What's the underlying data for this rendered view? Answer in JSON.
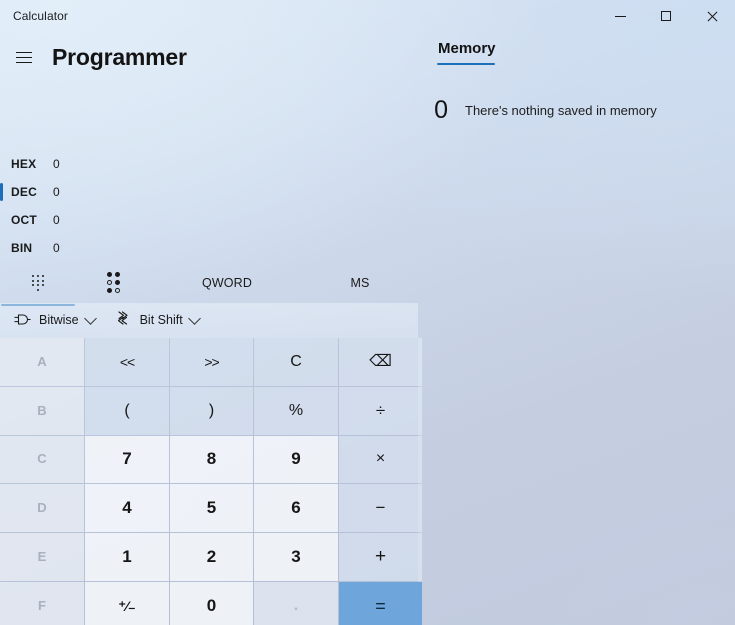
{
  "window": {
    "app_title": "Calculator",
    "controls": {
      "minimize": "minimize-button",
      "maximize": "maximize-button",
      "close": "close-button"
    }
  },
  "header": {
    "menu_icon": "hamburger-icon",
    "mode_title": "Programmer"
  },
  "memory": {
    "tab_label": "Memory",
    "result_value": "0",
    "empty_text": "There's nothing saved in memory"
  },
  "radix": {
    "rows": [
      {
        "label": "HEX",
        "value": "0",
        "selected": false
      },
      {
        "label": "DEC",
        "value": "0",
        "selected": true
      },
      {
        "label": "OCT",
        "value": "0",
        "selected": false
      },
      {
        "label": "BIN",
        "value": "0",
        "selected": false
      }
    ]
  },
  "keypad_tabs": [
    {
      "name": "keypad-tab",
      "label": "",
      "icon": "dot-grid-icon",
      "selected": true
    },
    {
      "name": "bit-toggle-tab",
      "label": "",
      "icon": "bit-dots-icon",
      "selected": false
    },
    {
      "name": "word-size-tab",
      "label": "QWORD",
      "icon": "",
      "selected": false
    },
    {
      "name": "memory-tab",
      "label": "MS",
      "icon": "",
      "selected": false
    }
  ],
  "bit_toolbar": {
    "bitwise": {
      "label": "Bitwise",
      "icon": "logic-gate-icon"
    },
    "bitshift": {
      "label": "Bit Shift",
      "icon": "bit-shift-icon"
    }
  },
  "keypad": {
    "rows": [
      [
        {
          "label": "A",
          "name": "key-a",
          "kind": "hex"
        },
        {
          "label": "<<",
          "name": "key-left-shift",
          "kind": "op"
        },
        {
          "label": ">>",
          "name": "key-right-shift",
          "kind": "op"
        },
        {
          "label": "C",
          "name": "key-clear",
          "kind": "op"
        },
        {
          "label": "⌫",
          "name": "key-backspace",
          "kind": "op"
        }
      ],
      [
        {
          "label": "B",
          "name": "key-b",
          "kind": "hex"
        },
        {
          "label": "(",
          "name": "key-open-paren",
          "kind": "op"
        },
        {
          "label": ")",
          "name": "key-close-paren",
          "kind": "op"
        },
        {
          "label": "%",
          "name": "key-modulo",
          "kind": "op"
        },
        {
          "label": "÷",
          "name": "key-divide",
          "kind": "op"
        }
      ],
      [
        {
          "label": "C",
          "name": "key-c",
          "kind": "hex"
        },
        {
          "label": "7",
          "name": "key-7",
          "kind": "num"
        },
        {
          "label": "8",
          "name": "key-8",
          "kind": "num"
        },
        {
          "label": "9",
          "name": "key-9",
          "kind": "num"
        },
        {
          "label": "×",
          "name": "key-multiply",
          "kind": "op"
        }
      ],
      [
        {
          "label": "D",
          "name": "key-d",
          "kind": "hex"
        },
        {
          "label": "4",
          "name": "key-4",
          "kind": "num"
        },
        {
          "label": "5",
          "name": "key-5",
          "kind": "num"
        },
        {
          "label": "6",
          "name": "key-6",
          "kind": "num"
        },
        {
          "label": "−",
          "name": "key-subtract",
          "kind": "op"
        }
      ],
      [
        {
          "label": "E",
          "name": "key-e",
          "kind": "hex"
        },
        {
          "label": "1",
          "name": "key-1",
          "kind": "num"
        },
        {
          "label": "2",
          "name": "key-2",
          "kind": "num"
        },
        {
          "label": "3",
          "name": "key-3",
          "kind": "num"
        },
        {
          "label": "+",
          "name": "key-add",
          "kind": "op"
        }
      ],
      [
        {
          "label": "F",
          "name": "key-f",
          "kind": "hex"
        },
        {
          "label": "⁺⁄₋",
          "name": "key-plus-minus",
          "kind": "num"
        },
        {
          "label": "0",
          "name": "key-0",
          "kind": "num"
        },
        {
          "label": ".",
          "name": "key-decimal",
          "kind": "disabled-dot"
        },
        {
          "label": "=",
          "name": "key-equals",
          "kind": "equals"
        }
      ]
    ]
  },
  "colors": {
    "accent": "#1d6fb8",
    "equals_button": "#6ea6dc",
    "text": "#161616",
    "disabled_text": "#a9b1bf"
  }
}
